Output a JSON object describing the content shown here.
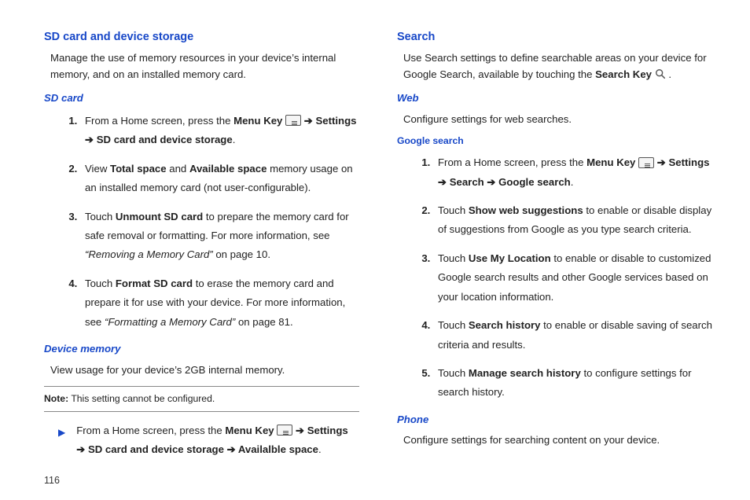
{
  "pageNumber": "116",
  "left": {
    "title": "SD card and device storage",
    "intro": "Manage the use of memory resources in your device’s internal memory, and on an installed memory card.",
    "sdCard": {
      "heading": "SD card",
      "steps": {
        "s1a": "From a Home screen, press the ",
        "s1b": "Menu Key",
        "s1c": " ➔ ",
        "s1d": "Settings",
        "s1e": " ➔ ",
        "s1f": "SD card and device storage",
        "s1g": ".",
        "s2a": "View ",
        "s2b": "Total space",
        "s2c": " and ",
        "s2d": "Available space",
        "s2e": " memory usage on an installed memory card (not user-configurable).",
        "s3a": "Touch ",
        "s3b": "Unmount SD card",
        "s3c": " to prepare the memory card for safe removal or formatting. For more information, see ",
        "s3d": "“Removing a Memory Card”",
        "s3e": " on page 10.",
        "s4a": "Touch ",
        "s4b": "Format SD card",
        "s4c": " to erase the memory card and prepare it for use with your device. For more information, see ",
        "s4d": "“Formatting a Memory Card”",
        "s4e": " on page 81."
      }
    },
    "devMem": {
      "heading": "Device memory",
      "intro": "View usage for your device’s 2GB internal memory.",
      "noteLabel": "Note:",
      "noteText": " This setting cannot be configured.",
      "b1a": "From a Home screen, press the ",
      "b1b": "Menu Key",
      "b1c": " ➔ ",
      "b1d": "Settings",
      "b1e": " ➔ ",
      "b1f": "SD card and device storage",
      "b1g": " ➔ ",
      "b1h": "Availalble space",
      "b1i": "."
    }
  },
  "right": {
    "title": "Search",
    "introA": "Use Search settings to define searchable areas on your device for Google Search, available by touching the ",
    "introB": "Search Key",
    "introC": " .",
    "web": {
      "heading": "Web",
      "intro": "Configure settings for web searches."
    },
    "google": {
      "heading": "Google search",
      "s1a": "From a Home screen, press the ",
      "s1b": "Menu Key",
      "s1c": " ➔ ",
      "s1d": "Settings",
      "s1e": " ➔ ",
      "s1f": "Search",
      "s1g": "  ➔ ",
      "s1h": "Google search",
      "s1i": ".",
      "s2a": "Touch ",
      "s2b": "Show web suggestions",
      "s2c": " to enable or disable display of suggestions from Google as you type search criteria.",
      "s3a": "Touch ",
      "s3b": "Use My Location",
      "s3c": " to enable or disable to customized Google search results and other Google services based on your location information.",
      "s4a": "Touch ",
      "s4b": "Search history",
      "s4c": " to enable or disable saving of search criteria and results.",
      "s5a": "Touch ",
      "s5b": "Manage search history",
      "s5c": " to configure settings for search history."
    },
    "phone": {
      "heading": "Phone",
      "intro": "Configure settings for searching content on your device."
    }
  }
}
